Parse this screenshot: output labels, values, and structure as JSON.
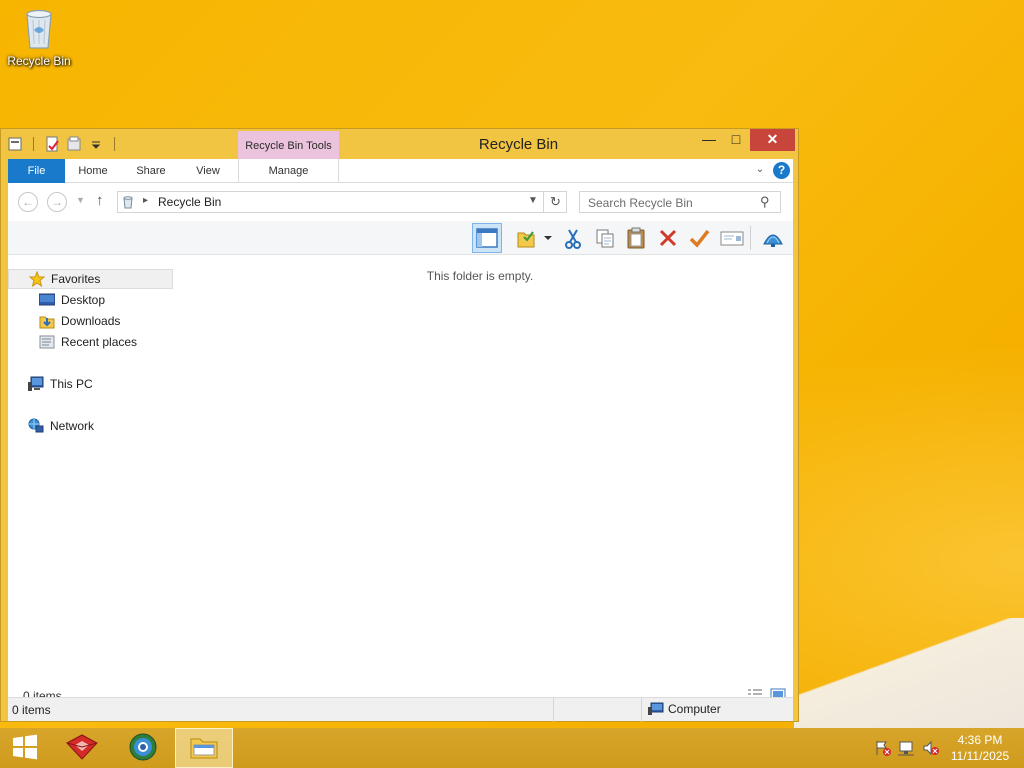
{
  "desktop": {
    "recycle_bin_label": "Recycle Bin"
  },
  "window": {
    "title": "Recycle Bin",
    "context_tab": "Recycle Bin Tools",
    "ribbon_tabs": {
      "file": "File",
      "home": "Home",
      "share": "Share",
      "view": "View",
      "manage": "Manage"
    },
    "help_label": "?",
    "address": {
      "path": "Recycle Bin"
    },
    "search": {
      "placeholder": "Search Recycle Bin"
    },
    "toolbar_icons": [
      "layout-pane-icon",
      "folder-options-icon",
      "cut-icon",
      "copy-icon",
      "paste-icon",
      "delete-icon",
      "rename-icon",
      "properties-icon",
      "shell-icon"
    ],
    "nav_pane": {
      "favorites": "Favorites",
      "desktop": "Desktop",
      "downloads": "Downloads",
      "recent": "Recent places",
      "this_pc": "This PC",
      "network": "Network"
    },
    "content": {
      "empty_text": "This folder is empty."
    },
    "items_count": "0 items",
    "status": {
      "items": "0 items",
      "location": "Computer"
    }
  },
  "taskbar": {
    "time": "4:36 PM",
    "date": "11/11/2025"
  },
  "colors": {
    "accent": "#1979ca",
    "close": "#c7453a",
    "frame": "#f1c542",
    "context_tab": "#ecc3dc"
  }
}
